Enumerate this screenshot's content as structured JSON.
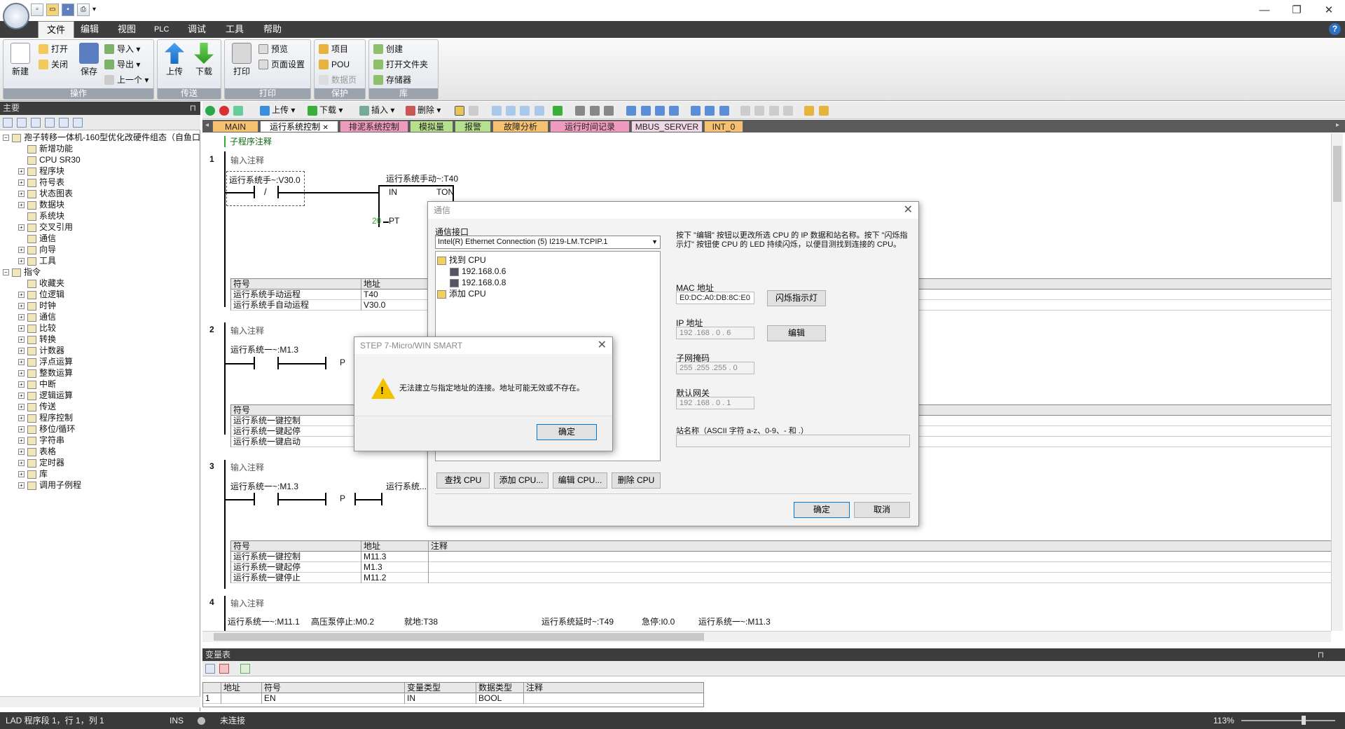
{
  "menu": [
    "文件",
    "编辑",
    "视图",
    "PLC",
    "调试",
    "工具",
    "帮助"
  ],
  "ribbon": {
    "operate": {
      "caption": "操作",
      "new": "新建",
      "open": "打开",
      "close": "关闭",
      "save": "保存",
      "import": "导入",
      "export": "导出",
      "prev": "上一个"
    },
    "transfer": {
      "caption": "传送",
      "upload": "上传",
      "download": "下载"
    },
    "print": {
      "caption": "打印",
      "print": "打印",
      "preview": "预览",
      "page_setup": "页面设置"
    },
    "protect": {
      "caption": "保护",
      "project": "项目",
      "pou": "POU",
      "data_page": "数据页"
    },
    "library": {
      "caption": "库",
      "create": "创建",
      "open_folder": "打开文件夹",
      "storage": "存储器"
    }
  },
  "left_pane": {
    "title": "主要",
    "tree": [
      {
        "label": "孢子转移一体机-160型优化改硬件组态（自鱼口",
        "level": 0,
        "exp": "−"
      },
      {
        "label": "新增功能",
        "level": 1,
        "exp": ""
      },
      {
        "label": "CPU SR30",
        "level": 1,
        "exp": ""
      },
      {
        "label": "程序块",
        "level": 1,
        "exp": "+"
      },
      {
        "label": "符号表",
        "level": 1,
        "exp": "+"
      },
      {
        "label": "状态图表",
        "level": 1,
        "exp": "+"
      },
      {
        "label": "数据块",
        "level": 1,
        "exp": "+"
      },
      {
        "label": "系统块",
        "level": 1,
        "exp": ""
      },
      {
        "label": "交叉引用",
        "level": 1,
        "exp": "+"
      },
      {
        "label": "通信",
        "level": 1,
        "exp": ""
      },
      {
        "label": "向导",
        "level": 1,
        "exp": "+"
      },
      {
        "label": "工具",
        "level": 1,
        "exp": "+"
      },
      {
        "label": "指令",
        "level": 0,
        "exp": "−"
      },
      {
        "label": "收藏夹",
        "level": 1,
        "exp": ""
      },
      {
        "label": "位逻辑",
        "level": 1,
        "exp": "+"
      },
      {
        "label": "时钟",
        "level": 1,
        "exp": "+"
      },
      {
        "label": "通信",
        "level": 1,
        "exp": "+"
      },
      {
        "label": "比较",
        "level": 1,
        "exp": "+"
      },
      {
        "label": "转换",
        "level": 1,
        "exp": "+"
      },
      {
        "label": "计数器",
        "level": 1,
        "exp": "+"
      },
      {
        "label": "浮点运算",
        "level": 1,
        "exp": "+"
      },
      {
        "label": "整数运算",
        "level": 1,
        "exp": "+"
      },
      {
        "label": "中断",
        "level": 1,
        "exp": "+"
      },
      {
        "label": "逻辑运算",
        "level": 1,
        "exp": "+"
      },
      {
        "label": "传送",
        "level": 1,
        "exp": "+"
      },
      {
        "label": "程序控制",
        "level": 1,
        "exp": "+"
      },
      {
        "label": "移位/循环",
        "level": 1,
        "exp": "+"
      },
      {
        "label": "字符串",
        "level": 1,
        "exp": "+"
      },
      {
        "label": "表格",
        "level": 1,
        "exp": "+"
      },
      {
        "label": "定时器",
        "level": 1,
        "exp": "+"
      },
      {
        "label": "库",
        "level": 1,
        "exp": "+"
      },
      {
        "label": "调用子例程",
        "level": 1,
        "exp": "+"
      }
    ]
  },
  "editor_toolbar": {
    "upload": "上传",
    "download": "下载",
    "insert": "插入",
    "delete": "删除"
  },
  "tabs": [
    "MAIN",
    "运行系统控制",
    "排泥系统控制",
    "模拟量",
    "报警",
    "故障分析",
    "运行时间记录",
    "MBUS_SERVER",
    "INT_0"
  ],
  "ladder": {
    "sub_comment": "子程序注释",
    "input_comment": "输入注释",
    "r1": {
      "num": "1",
      "contact": "运行系统手~:V30.0",
      "timer": "运行系统手动~:T40",
      "in": "IN",
      "ton": "TON",
      "pt_val": "20",
      "pt": "PT",
      "hdr": [
        "符号",
        "地址"
      ],
      "rows": [
        [
          "运行系统手动运程",
          "T40"
        ],
        [
          "运行系统手自动运程",
          "V30.0"
        ]
      ]
    },
    "r2": {
      "num": "2",
      "contact": "运行系统一~:M1.3",
      "coil": "P",
      "hdr": [
        "符号"
      ],
      "rows": [
        [
          "运行系统一键控制"
        ],
        [
          "运行系统一键起停"
        ],
        [
          "运行系统一键启动"
        ]
      ]
    },
    "r3": {
      "num": "3",
      "contact": "运行系统一~:M1.3",
      "coil": "P",
      "out": "运行系统...",
      "hdr": [
        "符号",
        "地址",
        "注释"
      ],
      "rows": [
        [
          "运行系统一键控制",
          "M11.3",
          ""
        ],
        [
          "运行系统一键起停",
          "M1.3",
          ""
        ],
        [
          "运行系统一键停止",
          "M11.2",
          ""
        ]
      ]
    },
    "r4": {
      "num": "4",
      "labels": [
        "运行系统一~:M11.1",
        "高压泵停止:M0.2",
        "就地:T38",
        "运行系统延时~:T49",
        "急停:I0.0",
        "运行系统一~:M11.3"
      ]
    }
  },
  "var_pane": {
    "title": "变量表",
    "hdr": [
      "地址",
      "符号",
      "变量类型",
      "数据类型",
      "注释"
    ],
    "rows": [
      [
        "1",
        "",
        "EN",
        "IN",
        "BOOL",
        ""
      ]
    ]
  },
  "status": {
    "pos": "LAD 程序段 1，行 1，列 1",
    "ins": "INS",
    "conn": "未连接",
    "zoom": "113%"
  },
  "comm_dialog": {
    "title": "通信",
    "iface_label": "通信接口",
    "iface_value": "Intel(R) Ethernet Connection (5) I219-LM.TCPIP.1",
    "tree": {
      "found": "找到 CPU",
      "ip1": "192.168.0.6",
      "ip2": "192.168.0.8",
      "add": "添加 CPU"
    },
    "help": "按下 \"编辑\" 按钮以更改所选 CPU 的 IP 数据和站名称。按下 \"闪烁指示灯\" 按钮使 CPU 的 LED 持续闪烁，以便目测找到连接的 CPU。",
    "mac_label": "MAC 地址",
    "mac": "E0:DC:A0:DB:8C:E0",
    "blink": "闪烁指示灯",
    "ip_label": "IP 地址",
    "ip": "192 .168 . 0 . 6",
    "edit": "编辑",
    "mask_label": "子网掩码",
    "mask": "255 .255 .255 . 0",
    "gw_label": "默认网关",
    "gw": "192 .168 . 0 . 1",
    "station_label": "站名称（ASCII 字符 a-z、0-9、- 和 .）",
    "find": "查找 CPU",
    "add": "添加 CPU...",
    "edit_cpu": "编辑 CPU...",
    "delete": "删除 CPU",
    "ok": "确定",
    "cancel": "取消"
  },
  "err_dialog": {
    "title": "STEP 7-Micro/WIN SMART",
    "msg": "无法建立与指定地址的连接。地址可能无效或不存在。",
    "ok": "确定"
  }
}
